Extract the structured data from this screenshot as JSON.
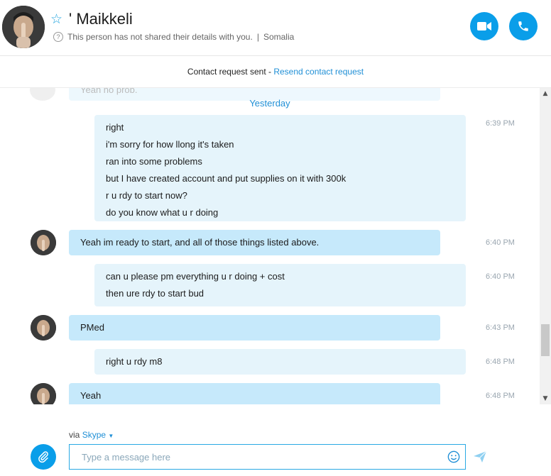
{
  "header": {
    "name": "' Maikkeli",
    "privacy_note": "This person has not shared their details with you.",
    "separator": "|",
    "location": "Somalia"
  },
  "banner": {
    "text": "Contact request sent - ",
    "link": "Resend contact request"
  },
  "chat": {
    "faded_preview": "Yeah no prob.",
    "day_label": "Yesterday",
    "messages": [
      {
        "from": "me",
        "lines": [
          "right",
          "i'm sorry for how llong it's taken",
          "ran into some problems",
          "but I have created account and put supplies on it with 300k",
          "r u rdy to start now?",
          "do you know what u r doing"
        ],
        "time": "6:39 PM"
      },
      {
        "from": "them",
        "text": "Yeah im ready to start, and all of those things listed above.",
        "time": "6:40 PM"
      },
      {
        "from": "me",
        "lines": [
          "can u please pm everything u r doing + cost",
          "then ure rdy to start bud"
        ],
        "time": "6:40 PM"
      },
      {
        "from": "them",
        "text": "PMed",
        "time": "6:43 PM"
      },
      {
        "from": "me",
        "lines": [
          "right u rdy m8"
        ],
        "time": "6:48 PM"
      },
      {
        "from": "them",
        "text": "Yeah",
        "time": "6:48 PM"
      }
    ]
  },
  "composer": {
    "via_label": "via",
    "via_service": "Skype",
    "placeholder": "Type a message here"
  },
  "icons": {
    "video": "video-call-icon",
    "audio": "audio-call-icon",
    "attach": "paperclip-icon",
    "emoji": "smiley-icon",
    "send": "send-icon",
    "favorite": "star-icon",
    "info": "question-icon"
  },
  "colors": {
    "accent": "#0a9ee9",
    "outgoing_bubble": "#e5f4fb",
    "incoming_bubble": "#c6e9fb"
  }
}
